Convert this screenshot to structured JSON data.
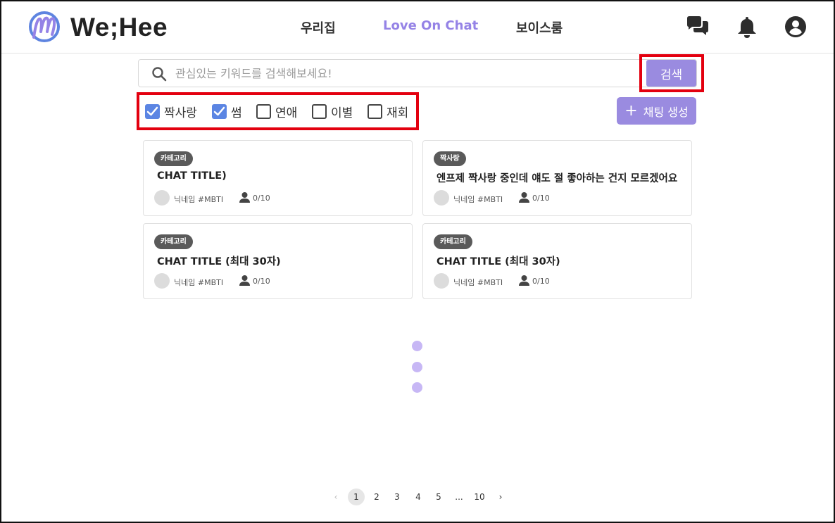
{
  "header": {
    "brand": "We;Hee",
    "nav": [
      {
        "label": "우리집",
        "active": false
      },
      {
        "label": "Love On Chat",
        "active": true
      },
      {
        "label": "보이스룸",
        "active": false
      }
    ],
    "icons": [
      "chat-bubbles-icon",
      "bell-icon",
      "account-icon"
    ]
  },
  "search": {
    "placeholder": "관심있는 키워드를 검색해보세요!",
    "value": "",
    "button_label": "검색"
  },
  "filters": [
    {
      "label": "짝사랑",
      "checked": true
    },
    {
      "label": "썸",
      "checked": true
    },
    {
      "label": "연애",
      "checked": false
    },
    {
      "label": "이별",
      "checked": false
    },
    {
      "label": "재회",
      "checked": false
    }
  ],
  "create_button": {
    "icon": "plus-icon",
    "label": "채팅 생성"
  },
  "cards": [
    {
      "category": "카테고리",
      "title": "CHAT TITLE)",
      "nickname": "닉네임 #MBTI",
      "participants": "0/10"
    },
    {
      "category": "짝사랑",
      "title": "엔프제 짝사랑 중인데 얘도 절 좋아하는 건지 모르겠어요",
      "nickname": "닉네임 #MBTI",
      "participants": "0/10"
    },
    {
      "category": "카테고리",
      "title": "CHAT TITLE  (최대 30자)",
      "nickname": "닉네임 #MBTI",
      "participants": "0/10"
    },
    {
      "category": "카테고리",
      "title": "CHAT TITLE  (최대 30자)",
      "nickname": "닉네임 #MBTI",
      "participants": "0/10"
    }
  ],
  "pagination": {
    "prev": "‹",
    "pages": [
      "1",
      "2",
      "3",
      "4",
      "5",
      "...",
      "10"
    ],
    "current": "1",
    "next": "›"
  },
  "colors": {
    "accent": "#9a8be0",
    "nav_active": "#9583e6",
    "checkbox": "#5b85e3",
    "badge": "#5a5a5a",
    "loading_dot": "#c7b7f5",
    "highlight": "#e3000f"
  }
}
